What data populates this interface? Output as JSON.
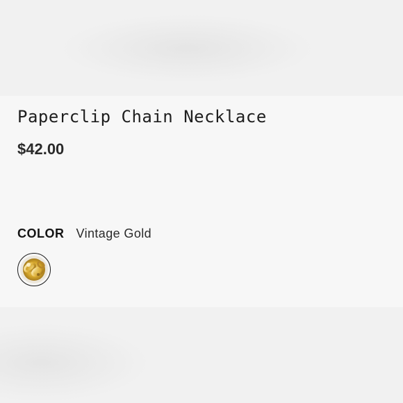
{
  "product": {
    "title": "Paperclip Chain Necklace",
    "price": "$42.00"
  },
  "options": {
    "color_label": "COLOR",
    "selected_color": "Vintage Gold",
    "swatches": [
      {
        "name": "Vintage Gold",
        "icon": "gold-chain-swatch",
        "selected": true
      }
    ]
  },
  "colors": {
    "background": "#f3f3f3",
    "panel": "#f7f7f7",
    "text": "#1e1e1e",
    "swatch_border": "#1a1a1a",
    "gold": "#d4a52a"
  }
}
